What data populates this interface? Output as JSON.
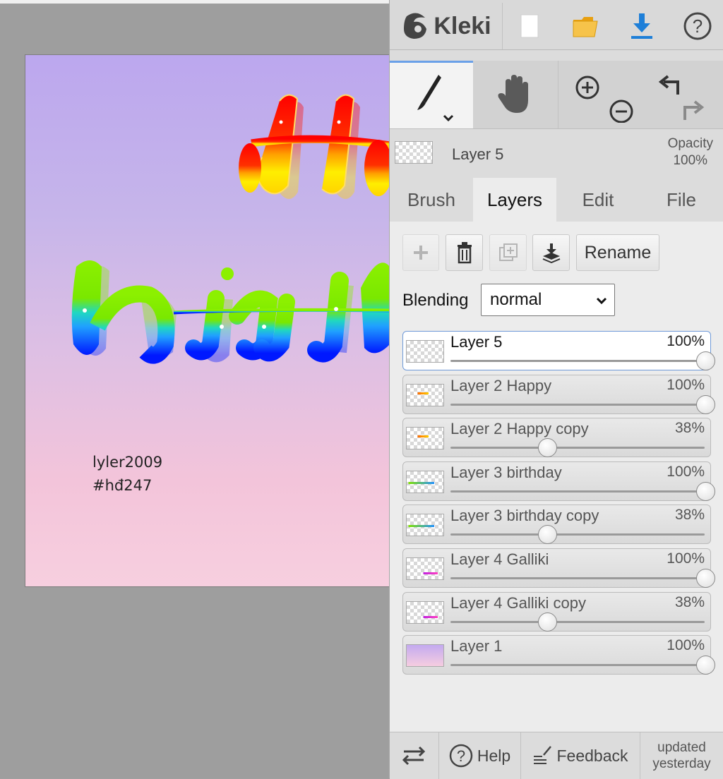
{
  "canvas": {
    "signature_line1": "lyler2009",
    "signature_line2": "#hđ247"
  },
  "topbar": {
    "app_name": "Kleki",
    "icons": [
      "kleki-logo-icon",
      "new-image-icon",
      "open-folder-icon",
      "download-icon",
      "help-icon"
    ]
  },
  "tools": {
    "icons": [
      "brush-tool-icon",
      "hand-tool-icon",
      "zoom-in-icon",
      "zoom-out-icon",
      "undo-icon",
      "redo-icon"
    ]
  },
  "current_layer": {
    "name": "Layer 5",
    "opacity_label": "Opacity",
    "opacity_value": "100%"
  },
  "tabs": [
    "Brush",
    "Layers",
    "Edit",
    "File"
  ],
  "active_tab": "Layers",
  "layer_buttons": {
    "rename_label": "Rename"
  },
  "blending": {
    "label": "Blending",
    "value": "normal"
  },
  "layers": [
    {
      "name": "Layer 5",
      "opacity": "100%",
      "fraction": 1.0,
      "selected": true
    },
    {
      "name": "Layer 2 Happy",
      "opacity": "100%",
      "fraction": 1.0,
      "selected": false
    },
    {
      "name": "Layer 2 Happy copy",
      "opacity": "38%",
      "fraction": 0.38,
      "selected": false
    },
    {
      "name": "Layer 3 birthday",
      "opacity": "100%",
      "fraction": 1.0,
      "selected": false
    },
    {
      "name": "Layer 3 birthday copy",
      "opacity": "38%",
      "fraction": 0.38,
      "selected": false
    },
    {
      "name": "Layer 4 Galliki",
      "opacity": "100%",
      "fraction": 1.0,
      "selected": false
    },
    {
      "name": "Layer 4 Galliki copy",
      "opacity": "38%",
      "fraction": 0.38,
      "selected": false
    },
    {
      "name": "Layer 1",
      "opacity": "100%",
      "fraction": 1.0,
      "selected": false
    }
  ],
  "bottombar": {
    "help_label": "Help",
    "feedback_label": "Feedback",
    "updated_line1": "updated",
    "updated_line2": "yesterday"
  },
  "colors": {
    "accent": "#6aa0e8",
    "download": "#1e7fd8",
    "folder": "#f0b428",
    "panel_bg": "#dcdcdc"
  }
}
